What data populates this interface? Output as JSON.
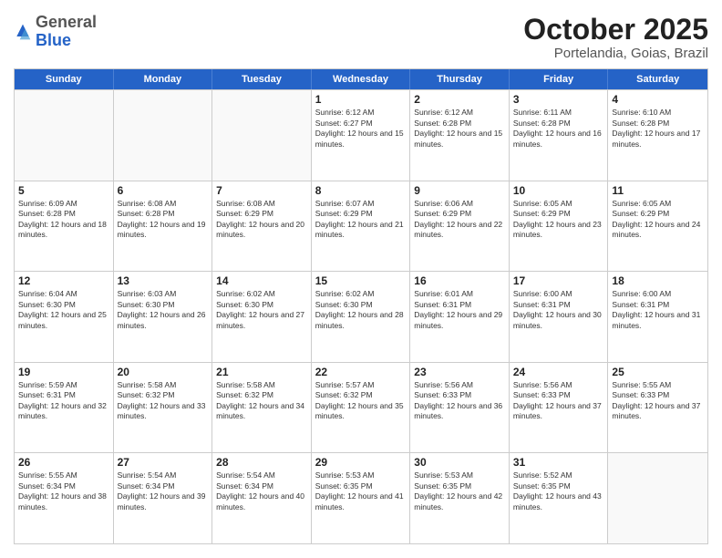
{
  "header": {
    "logo": {
      "general": "General",
      "blue": "Blue"
    },
    "title": "October 2025",
    "location": "Portelandia, Goias, Brazil"
  },
  "calendar": {
    "days_of_week": [
      "Sunday",
      "Monday",
      "Tuesday",
      "Wednesday",
      "Thursday",
      "Friday",
      "Saturday"
    ],
    "rows": [
      [
        {
          "day": "",
          "empty": true
        },
        {
          "day": "",
          "empty": true
        },
        {
          "day": "",
          "empty": true
        },
        {
          "day": "1",
          "sunrise": "6:12 AM",
          "sunset": "6:27 PM",
          "daylight": "12 hours and 15 minutes."
        },
        {
          "day": "2",
          "sunrise": "6:12 AM",
          "sunset": "6:28 PM",
          "daylight": "12 hours and 15 minutes."
        },
        {
          "day": "3",
          "sunrise": "6:11 AM",
          "sunset": "6:28 PM",
          "daylight": "12 hours and 16 minutes."
        },
        {
          "day": "4",
          "sunrise": "6:10 AM",
          "sunset": "6:28 PM",
          "daylight": "12 hours and 17 minutes."
        }
      ],
      [
        {
          "day": "5",
          "sunrise": "6:09 AM",
          "sunset": "6:28 PM",
          "daylight": "12 hours and 18 minutes."
        },
        {
          "day": "6",
          "sunrise": "6:08 AM",
          "sunset": "6:28 PM",
          "daylight": "12 hours and 19 minutes."
        },
        {
          "day": "7",
          "sunrise": "6:08 AM",
          "sunset": "6:29 PM",
          "daylight": "12 hours and 20 minutes."
        },
        {
          "day": "8",
          "sunrise": "6:07 AM",
          "sunset": "6:29 PM",
          "daylight": "12 hours and 21 minutes."
        },
        {
          "day": "9",
          "sunrise": "6:06 AM",
          "sunset": "6:29 PM",
          "daylight": "12 hours and 22 minutes."
        },
        {
          "day": "10",
          "sunrise": "6:05 AM",
          "sunset": "6:29 PM",
          "daylight": "12 hours and 23 minutes."
        },
        {
          "day": "11",
          "sunrise": "6:05 AM",
          "sunset": "6:29 PM",
          "daylight": "12 hours and 24 minutes."
        }
      ],
      [
        {
          "day": "12",
          "sunrise": "6:04 AM",
          "sunset": "6:30 PM",
          "daylight": "12 hours and 25 minutes."
        },
        {
          "day": "13",
          "sunrise": "6:03 AM",
          "sunset": "6:30 PM",
          "daylight": "12 hours and 26 minutes."
        },
        {
          "day": "14",
          "sunrise": "6:02 AM",
          "sunset": "6:30 PM",
          "daylight": "12 hours and 27 minutes."
        },
        {
          "day": "15",
          "sunrise": "6:02 AM",
          "sunset": "6:30 PM",
          "daylight": "12 hours and 28 minutes."
        },
        {
          "day": "16",
          "sunrise": "6:01 AM",
          "sunset": "6:31 PM",
          "daylight": "12 hours and 29 minutes."
        },
        {
          "day": "17",
          "sunrise": "6:00 AM",
          "sunset": "6:31 PM",
          "daylight": "12 hours and 30 minutes."
        },
        {
          "day": "18",
          "sunrise": "6:00 AM",
          "sunset": "6:31 PM",
          "daylight": "12 hours and 31 minutes."
        }
      ],
      [
        {
          "day": "19",
          "sunrise": "5:59 AM",
          "sunset": "6:31 PM",
          "daylight": "12 hours and 32 minutes."
        },
        {
          "day": "20",
          "sunrise": "5:58 AM",
          "sunset": "6:32 PM",
          "daylight": "12 hours and 33 minutes."
        },
        {
          "day": "21",
          "sunrise": "5:58 AM",
          "sunset": "6:32 PM",
          "daylight": "12 hours and 34 minutes."
        },
        {
          "day": "22",
          "sunrise": "5:57 AM",
          "sunset": "6:32 PM",
          "daylight": "12 hours and 35 minutes."
        },
        {
          "day": "23",
          "sunrise": "5:56 AM",
          "sunset": "6:33 PM",
          "daylight": "12 hours and 36 minutes."
        },
        {
          "day": "24",
          "sunrise": "5:56 AM",
          "sunset": "6:33 PM",
          "daylight": "12 hours and 37 minutes."
        },
        {
          "day": "25",
          "sunrise": "5:55 AM",
          "sunset": "6:33 PM",
          "daylight": "12 hours and 37 minutes."
        }
      ],
      [
        {
          "day": "26",
          "sunrise": "5:55 AM",
          "sunset": "6:34 PM",
          "daylight": "12 hours and 38 minutes."
        },
        {
          "day": "27",
          "sunrise": "5:54 AM",
          "sunset": "6:34 PM",
          "daylight": "12 hours and 39 minutes."
        },
        {
          "day": "28",
          "sunrise": "5:54 AM",
          "sunset": "6:34 PM",
          "daylight": "12 hours and 40 minutes."
        },
        {
          "day": "29",
          "sunrise": "5:53 AM",
          "sunset": "6:35 PM",
          "daylight": "12 hours and 41 minutes."
        },
        {
          "day": "30",
          "sunrise": "5:53 AM",
          "sunset": "6:35 PM",
          "daylight": "12 hours and 42 minutes."
        },
        {
          "day": "31",
          "sunrise": "5:52 AM",
          "sunset": "6:35 PM",
          "daylight": "12 hours and 43 minutes."
        },
        {
          "day": "",
          "empty": true
        }
      ]
    ]
  }
}
